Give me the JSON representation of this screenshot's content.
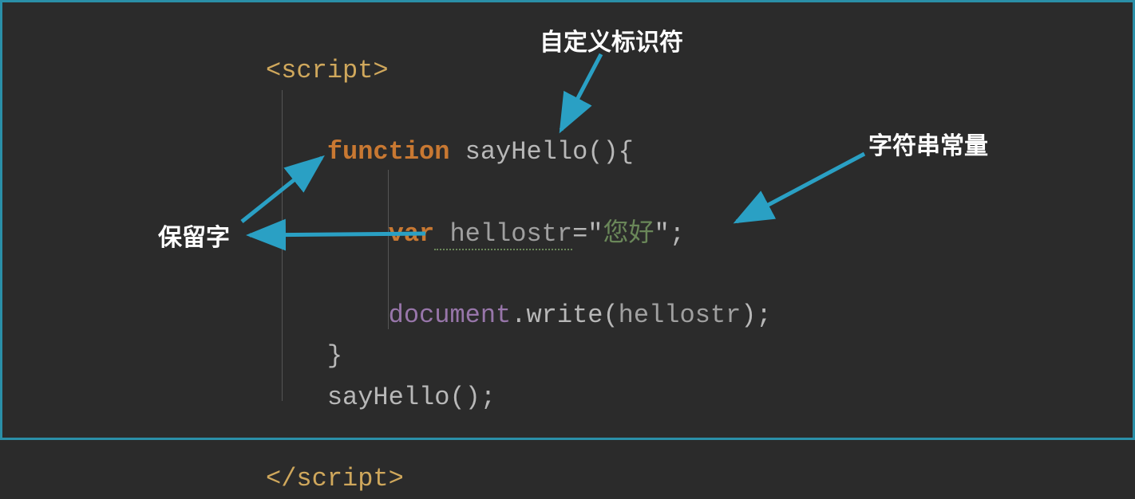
{
  "annotations": {
    "identifier": "自定义标识符",
    "stringConst": "字符串常量",
    "reserved": "保留字"
  },
  "code": {
    "openTag": "<script>",
    "closeTag": "</script>",
    "kw_function": "function",
    "fn_name": " sayHello",
    "fn_parens": "(){",
    "kw_var": "var",
    "var_name": " hellostr",
    "assign_open": "=\"",
    "string_val": "您好",
    "assign_close": "\";",
    "doc": "document",
    "dot": ".",
    "method": "write",
    "call_open": "(",
    "call_arg": "hellostr",
    "call_close": ");",
    "close_brace": "}",
    "invoke": "sayHello();"
  }
}
